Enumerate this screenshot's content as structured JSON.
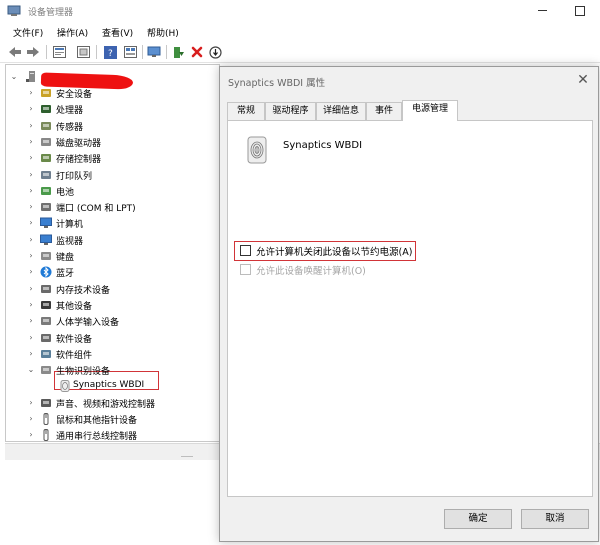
{
  "device_manager": {
    "title": "设备管理器",
    "menu": [
      "文件(F)",
      "操作(A)",
      "查看(V)",
      "帮助(H)"
    ],
    "toolbar_icons": [
      "back-icon",
      "forward-icon",
      "properties-icon",
      "refresh-icon",
      "help-icon",
      "view-icon",
      "monitor-icon",
      "update-driver-icon",
      "uninstall-icon",
      "disable-icon"
    ],
    "tree": [
      {
        "label": "安全设备",
        "icon": "security-icon"
      },
      {
        "label": "处理器",
        "icon": "processor-icon"
      },
      {
        "label": "传感器",
        "icon": "sensor-icon"
      },
      {
        "label": "磁盘驱动器",
        "icon": "disk-icon"
      },
      {
        "label": "存储控制器",
        "icon": "storage-icon"
      },
      {
        "label": "打印队列",
        "icon": "printer-icon"
      },
      {
        "label": "电池",
        "icon": "battery-icon"
      },
      {
        "label": "端口 (COM 和 LPT)",
        "icon": "port-icon"
      },
      {
        "label": "计算机",
        "icon": "computer-icon"
      },
      {
        "label": "监视器",
        "icon": "monitor-icon"
      },
      {
        "label": "键盘",
        "icon": "keyboard-icon"
      },
      {
        "label": "蓝牙",
        "icon": "bluetooth-icon"
      },
      {
        "label": "内存技术设备",
        "icon": "memory-icon"
      },
      {
        "label": "其他设备",
        "icon": "other-device-icon"
      },
      {
        "label": "人体学输入设备",
        "icon": "hid-icon"
      },
      {
        "label": "软件设备",
        "icon": "software-device-icon"
      },
      {
        "label": "软件组件",
        "icon": "software-component-icon"
      },
      {
        "label": "生物识别设备",
        "icon": "biometric-icon"
      },
      {
        "label": "Synaptics WBDI",
        "icon": "fingerprint-icon"
      },
      {
        "label": "声音、视频和游戏控制器",
        "icon": "sound-icon"
      },
      {
        "label": "鼠标和其他指针设备",
        "icon": "mouse-icon"
      },
      {
        "label": "通用串行总线控制器",
        "icon": "usb-icon"
      }
    ]
  },
  "properties_dialog": {
    "title": "Synaptics WBDI 属性",
    "tabs": [
      "常规",
      "驱动程序",
      "详细信息",
      "事件",
      "电源管理"
    ],
    "active_tab": "电源管理",
    "device_name": "Synaptics WBDI",
    "options": [
      {
        "label": "允许计算机关闭此设备以节约电源(A)",
        "checked": false,
        "enabled": true
      },
      {
        "label": "允许此设备唤醒计算机(O)",
        "checked": false,
        "enabled": false
      }
    ],
    "ok_label": "确定",
    "cancel_label": "取消"
  },
  "colors": {
    "highlight": "#d13438",
    "redaction": "#ee1111",
    "dialog_bg": "#f0f0f0"
  }
}
